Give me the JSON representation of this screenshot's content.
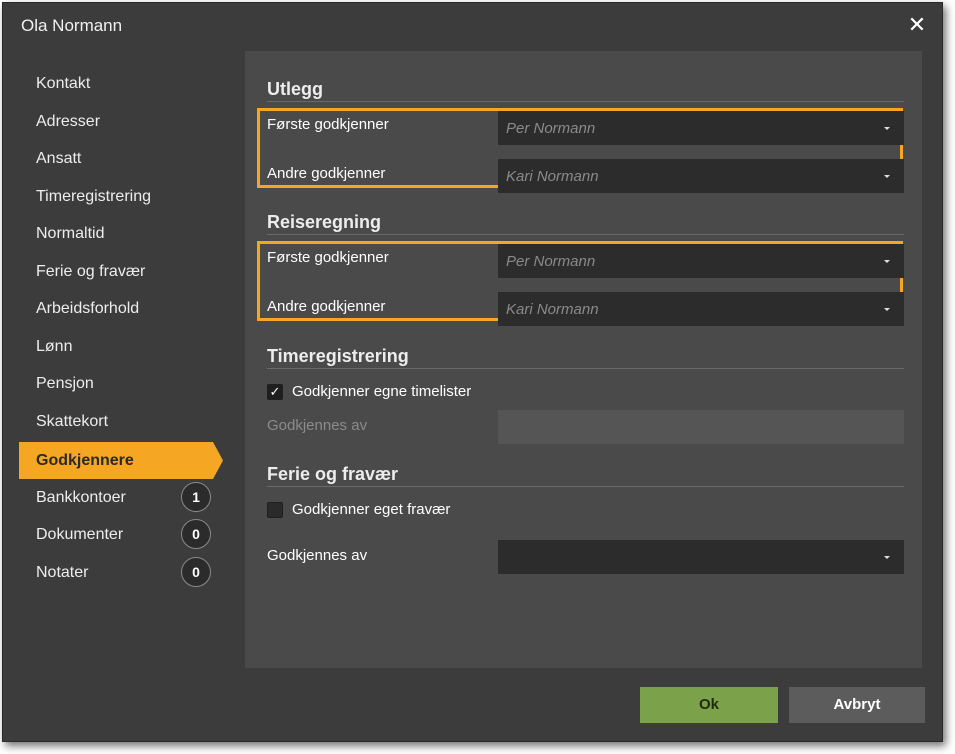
{
  "window": {
    "title": "Ola Normann",
    "close_icon": "close-icon"
  },
  "sidebar": {
    "items": [
      {
        "label": "Kontakt"
      },
      {
        "label": "Adresser"
      },
      {
        "label": "Ansatt"
      },
      {
        "label": "Timeregistrering"
      },
      {
        "label": "Normaltid"
      },
      {
        "label": "Ferie og fravær"
      },
      {
        "label": "Arbeidsforhold"
      },
      {
        "label": "Lønn"
      },
      {
        "label": "Pensjon"
      },
      {
        "label": "Skattekort"
      },
      {
        "label": "Godkjennere",
        "active": true
      },
      {
        "label": "Bankkontoer",
        "badge": "1"
      },
      {
        "label": "Dokumenter",
        "badge": "0"
      },
      {
        "label": "Notater",
        "badge": "0"
      }
    ]
  },
  "utlegg": {
    "title": "Utlegg",
    "first_label": "Første godkjenner",
    "first_placeholder": "Per Normann",
    "second_label": "Andre godkjenner",
    "second_placeholder": "Kari Normann"
  },
  "reiseregning": {
    "title": "Reiseregning",
    "first_label": "Første godkjenner",
    "first_placeholder": "Per Normann",
    "second_label": "Andre godkjenner",
    "second_placeholder": "Kari Normann"
  },
  "timeregistrering": {
    "title": "Timeregistrering",
    "checkbox_label": "Godkjenner egne timelister",
    "checked": true,
    "approved_by_label": "Godkjennes av"
  },
  "ferie": {
    "title": "Ferie og fravær",
    "checkbox_label": "Godkjenner eget fravær",
    "checked": false,
    "approved_by_label": "Godkjennes av"
  },
  "buttons": {
    "ok": "Ok",
    "cancel": "Avbryt"
  },
  "colors": {
    "accent": "#f5a623",
    "ok": "#7ba24a",
    "background": "#3c3c3c",
    "panel": "#4a4a4a"
  }
}
